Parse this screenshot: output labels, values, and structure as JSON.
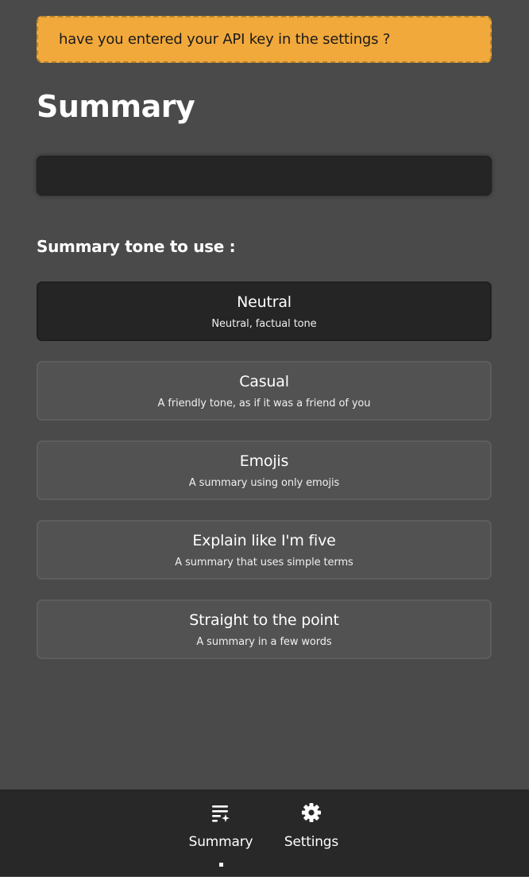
{
  "alert": {
    "message": "have you entered your API key in the settings ?",
    "color": "#f2a93b"
  },
  "page": {
    "title": "Summary",
    "input_value": ""
  },
  "tone_section": {
    "label": "Summary tone to use :",
    "selected": "Neutral",
    "options": [
      {
        "title": "Neutral",
        "description": "Neutral, factual tone"
      },
      {
        "title": "Casual",
        "description": "A friendly tone, as if it was a friend of you"
      },
      {
        "title": "Emojis",
        "description": "A summary using only emojis"
      },
      {
        "title": "Explain like I'm five",
        "description": "A summary that uses simple terms"
      },
      {
        "title": "Straight to the point",
        "description": "A summary in a few words"
      }
    ]
  },
  "bottom_nav": {
    "active": "Summary",
    "items": [
      {
        "label": "Summary",
        "icon": "summary-lines-sparkle-icon"
      },
      {
        "label": "Settings",
        "icon": "gear-icon"
      }
    ]
  }
}
